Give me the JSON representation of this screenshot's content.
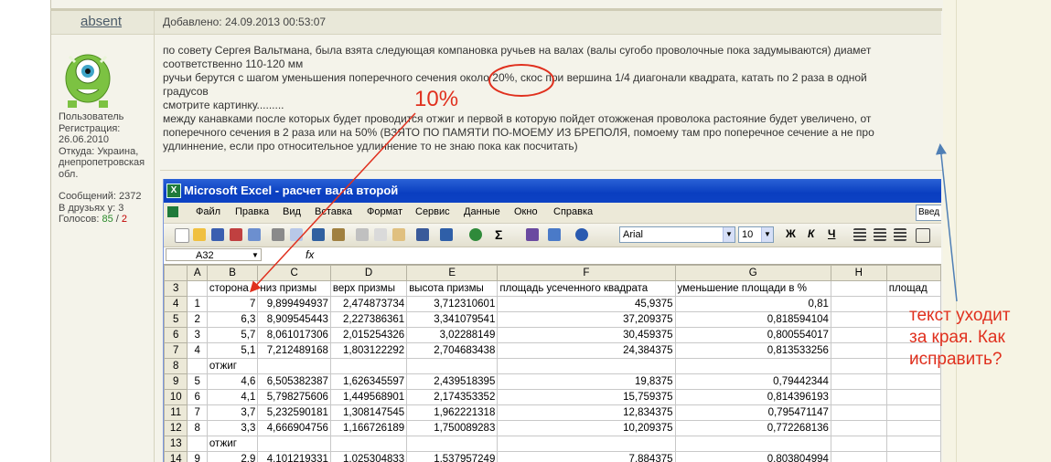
{
  "post": {
    "author": "absent",
    "date": "Добавлено: 24.09.2013 00:53:07",
    "lines": [
      "по совету Сергея Вальтмана, была взята следующая компановка ручьев на валах (валы сугобо проволочные пока задумываются) диамет",
      "соответственно 110-120 мм",
      "ручьи берутся с шагом уменьшения поперечного сечения около 20%, скос при вершина 1/4 диагонали квадрата, катать по 2 раза в одной",
      "градусов",
      "смотрите картинку.........",
      "между канавками после которых будет проводится отжиг и первой в которую пойдет отожженая проволока растояние будет увеличено, от",
      "поперечного сечения в 2 раза или на 50% (ВЗЯТО ПО ПАМЯТИ ПО-МОЕМУ ИЗ БРЕПОЛЯ, помоему там про поперечное сечение а не про",
      "удлиннение, если про относительное удлиннение то не знаю пока как посчитать)"
    ]
  },
  "user": {
    "role": "Пользователь",
    "registration_label": "Регистрация:",
    "registration_date": "26.06.2010",
    "location_line1": "Откуда: Украина,",
    "location_line2": "днепропетровская",
    "location_line3": "обл.",
    "messages": "Сообщений: 2372",
    "friends": "В друзьях у: 3",
    "votes_label": "Голосов:",
    "votes_pos": "85",
    "votes_neg": "2"
  },
  "excel": {
    "app_icon_letter": "X",
    "title": "Microsoft Excel - расчет вала второй",
    "menu": [
      "Файл",
      "Правка",
      "Вид",
      "Вставка",
      "Формат",
      "Сервис",
      "Данные",
      "Окно",
      "Справка"
    ],
    "help_box": "Введ",
    "toolbar": {
      "autosum": "Σ",
      "font": "Arial",
      "size": "10",
      "bold": "Ж",
      "italic": "К",
      "underline": "Ч"
    },
    "name_box": "A32",
    "fx_label": "fx",
    "col_headers": [
      "A",
      "B",
      "C",
      "D",
      "E",
      "F",
      "G",
      "H"
    ],
    "rows": [
      {
        "n": "3",
        "cells": [
          "",
          "сторона",
          "низ призмы",
          "верх призмы",
          "высота призмы",
          "площадь усеченного квадрата",
          "уменьшение площади в %",
          "",
          "площад"
        ]
      },
      {
        "n": "4",
        "cells": [
          "1",
          "7",
          "9,899494937",
          "2,474873734",
          "3,712310601",
          "45,9375",
          "0,81",
          "",
          ""
        ]
      },
      {
        "n": "5",
        "cells": [
          "2",
          "6,3",
          "8,909545443",
          "2,227386361",
          "3,341079541",
          "37,209375",
          "0,818594104",
          "",
          ""
        ]
      },
      {
        "n": "6",
        "cells": [
          "3",
          "5,7",
          "8,061017306",
          "2,015254326",
          "3,02288149",
          "30,459375",
          "0,800554017",
          "",
          ""
        ]
      },
      {
        "n": "7",
        "cells": [
          "4",
          "5,1",
          "7,212489168",
          "1,803122292",
          "2,704683438",
          "24,384375",
          "0,813533256",
          "",
          ""
        ]
      },
      {
        "n": "8",
        "cells": [
          "",
          "отжиг",
          "",
          "",
          "",
          "",
          "",
          "",
          ""
        ]
      },
      {
        "n": "9",
        "cells": [
          "5",
          "4,6",
          "6,505382387",
          "1,626345597",
          "2,439518395",
          "19,8375",
          "0,79442344",
          "",
          ""
        ]
      },
      {
        "n": "10",
        "cells": [
          "6",
          "4,1",
          "5,798275606",
          "1,449568901",
          "2,174353352",
          "15,759375",
          "0,814396193",
          "",
          ""
        ]
      },
      {
        "n": "11",
        "cells": [
          "7",
          "3,7",
          "5,232590181",
          "1,308147545",
          "1,962221318",
          "12,834375",
          "0,795471147",
          "",
          ""
        ]
      },
      {
        "n": "12",
        "cells": [
          "8",
          "3,3",
          "4,666904756",
          "1,166726189",
          "1,750089283",
          "10,209375",
          "0,772268136",
          "",
          ""
        ]
      },
      {
        "n": "13",
        "cells": [
          "",
          "отжиг",
          "",
          "",
          "",
          "",
          "",
          "",
          ""
        ]
      },
      {
        "n": "14",
        "cells": [
          "9",
          "2,9",
          "4,101219331",
          "1,025304833",
          "1,537957249",
          "7,884375",
          "0,803804994",
          "",
          ""
        ]
      }
    ]
  },
  "annotations": {
    "ten_percent": "10%",
    "note": [
      "текст уходит",
      "за края. Как",
      "исправить?"
    ]
  }
}
